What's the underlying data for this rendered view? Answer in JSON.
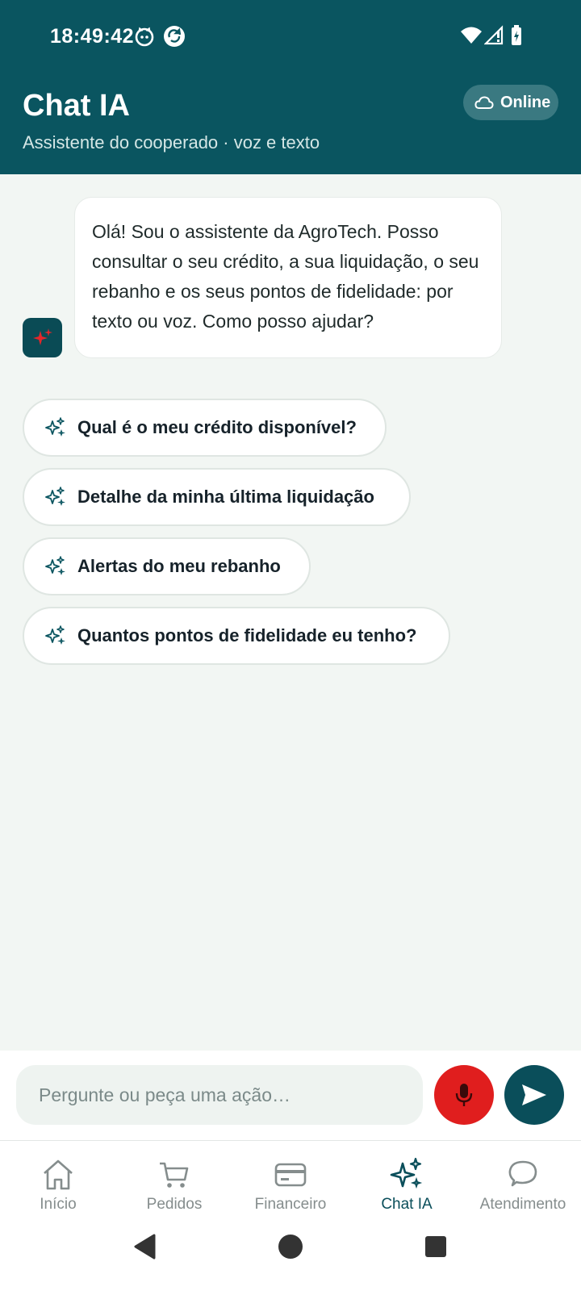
{
  "status_bar": {
    "time": "18:49:42"
  },
  "header": {
    "title": "Chat IA",
    "subtitle": "Assistente do cooperado · voz e texto",
    "status_label": "Online"
  },
  "chat": {
    "assistant_message": "Olá! Sou o assistente da AgroTech. Posso consultar o seu crédito, a sua liquidação, o seu rebanho e os seus pontos de fidelidade: por texto ou voz. Como posso ajudar?"
  },
  "suggestions": [
    "Qual é o meu crédito disponível?",
    "Detalhe da minha última liquidação",
    "Alertas do meu rebanho",
    "Quantos pontos de fidelidade eu tenho?"
  ],
  "composer": {
    "placeholder": "Pergunte ou peça uma ação…",
    "value": ""
  },
  "nav": {
    "items": [
      {
        "label": "Início",
        "icon": "home-icon"
      },
      {
        "label": "Pedidos",
        "icon": "cart-icon"
      },
      {
        "label": "Financeiro",
        "icon": "card-icon"
      },
      {
        "label": "Chat IA",
        "icon": "sparkles-icon"
      },
      {
        "label": "Atendimento",
        "icon": "chat-bubble-icon"
      }
    ],
    "active": "Chat IA"
  },
  "colors": {
    "header_bg": "#0a5560",
    "page_bg": "#f2f6f3",
    "mic_red": "#e01e1e",
    "send_teal": "#0a4e5a",
    "active_nav": "#0a4e5a"
  }
}
